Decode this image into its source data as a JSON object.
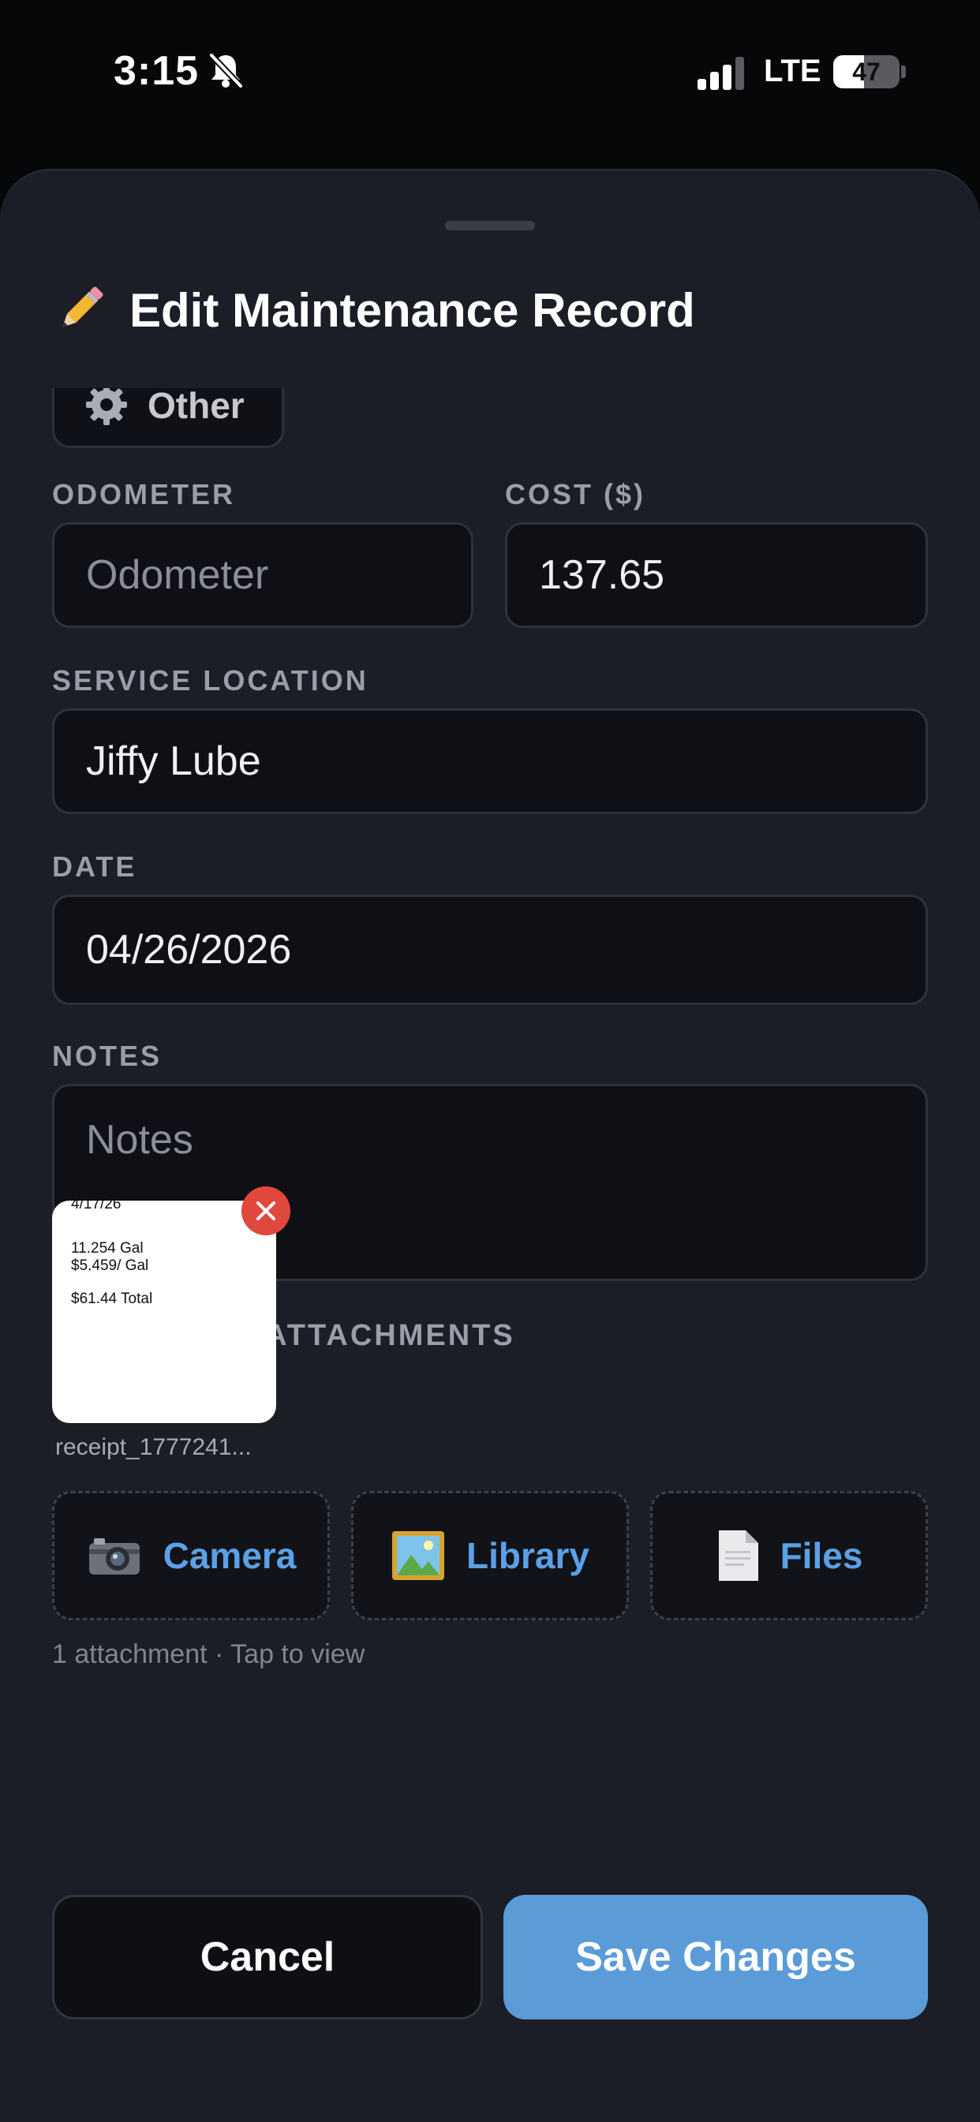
{
  "status_bar": {
    "time": "3:15",
    "network": "LTE",
    "battery_level": "47",
    "battery_fraction": 0.47,
    "icons": [
      "bell-slash-icon",
      "signal-bars-icon",
      "battery-icon"
    ]
  },
  "sheet": {
    "title": "Edit Maintenance Record",
    "title_icon": "pencil-icon"
  },
  "category_chip": {
    "label": "Other",
    "icon": "gear-icon"
  },
  "form": {
    "odometer": {
      "label": "ODOMETER",
      "value": "",
      "placeholder": "Odometer"
    },
    "cost": {
      "label": "COST ($)",
      "value": "137.65"
    },
    "service_location": {
      "label": "SERVICE LOCATION",
      "value": "Jiffy Lube"
    },
    "date": {
      "label": "DATE",
      "value": "04/26/2026"
    },
    "notes": {
      "label": "NOTES",
      "value": "",
      "placeholder": "Notes"
    }
  },
  "attachments": {
    "label": "RECEIPTS & ATTACHMENTS",
    "items": [
      {
        "filename": "receipt_1777241...",
        "preview_lines": [
          "4/17/26",
          "11.254 Gal",
          "$5.459/ Gal",
          "$61.44 Total"
        ]
      }
    ],
    "buttons": {
      "camera": "Camera",
      "library": "Library",
      "files": "Files"
    },
    "count_text": "1 attachment · Tap to view"
  },
  "actions": {
    "cancel": "Cancel",
    "save": "Save Changes"
  },
  "colors": {
    "sheet_bg": "#1b1e26",
    "accent": "#5a9bd8",
    "link": "#5aa1e6",
    "danger": "#e0483e"
  }
}
